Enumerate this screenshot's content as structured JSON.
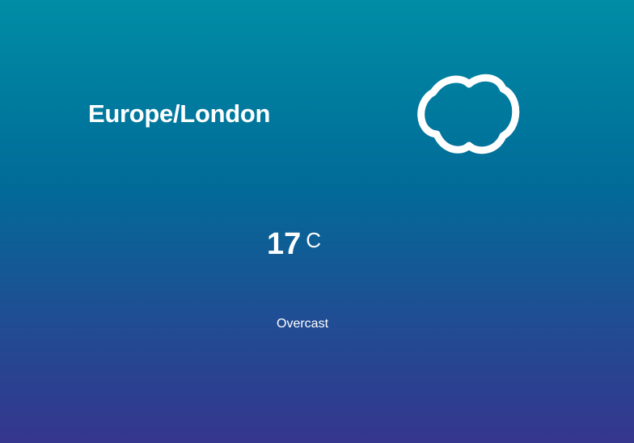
{
  "weather": {
    "location": "Europe/London",
    "temperature": "17",
    "unit": "C",
    "condition": "Overcast",
    "icon": "cloud-icon"
  },
  "colors": {
    "gradient_top": "#008da5",
    "gradient_bottom": "#35368d",
    "text": "#ffffff"
  }
}
